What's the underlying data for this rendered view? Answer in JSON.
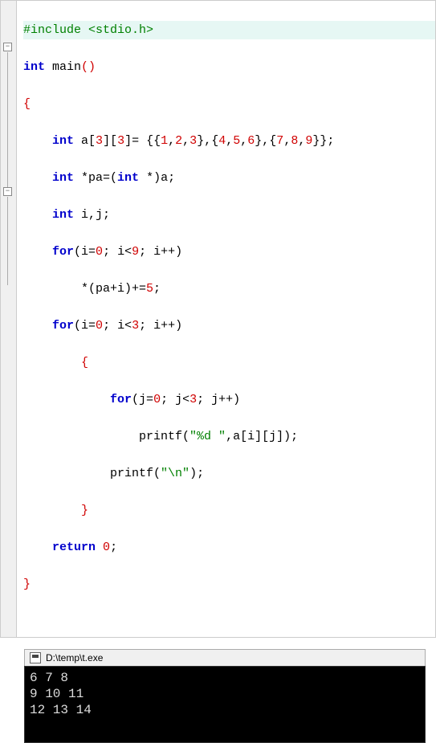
{
  "code": {
    "l1_include_kw": "#include",
    "l1_include_rest": " <stdio.h>",
    "l2_kw1": "int",
    "l2_main": " main",
    "l2_paren": "()",
    "l3_brace": "{",
    "l4_indent": "    ",
    "l4_kw": "int",
    "l4_pre": " a[",
    "l4_n1": "3",
    "l4_mid1": "][",
    "l4_n2": "3",
    "l4_mid2": "]= {{",
    "l4_v1": "1",
    "l4_c": ",",
    "l4_v2": "2",
    "l4_v3": "3",
    "l4_mid3": "},{",
    "l4_v4": "4",
    "l4_v5": "5",
    "l4_v6": "6",
    "l4_v7": "7",
    "l4_v8": "8",
    "l4_v9": "9",
    "l4_end": "}};",
    "l5_kw": "int",
    "l5_rest1": " *pa=(",
    "l5_kw2": "int",
    "l5_rest2": " *)a;",
    "l6_kw": "int",
    "l6_rest": " i,j;",
    "l7_kw": "for",
    "l7_a": "(i=",
    "l7_n0": "0",
    "l7_b": "; i<",
    "l7_n9": "9",
    "l7_c": "; i++)",
    "l8_indent": "        ",
    "l8_a": "*(pa+i)+=",
    "l8_n5": "5",
    "l8_semi": ";",
    "l9_kw": "for",
    "l9_a": "(i=",
    "l9_n0": "0",
    "l9_b": "; i<",
    "l9_n3": "3",
    "l9_c": "; i++)",
    "l10_brace": "        {",
    "l11_indent": "            ",
    "l11_kw": "for",
    "l11_a": "(j=",
    "l11_n0": "0",
    "l11_b": "; j<",
    "l11_n3": "3",
    "l11_c": "; j++)",
    "l12_indent": "                ",
    "l12_fn": "printf(",
    "l12_str": "\"%d \"",
    "l12_rest": ",a[i][j]);",
    "l13_indent": "            ",
    "l13_fn": "printf(",
    "l13_str": "\"\\n\"",
    "l13_rest": ");",
    "l14_brace": "        }",
    "l15_kw": "return",
    "l15_sp": " ",
    "l15_n0": "0",
    "l15_semi": ";",
    "l16_brace": "}"
  },
  "console": {
    "title": "D:\\temp\\t.exe",
    "line1": "6 7 8",
    "line2": "9 10 11",
    "line3": "12 13 14"
  },
  "fold": {
    "minus": "−"
  }
}
